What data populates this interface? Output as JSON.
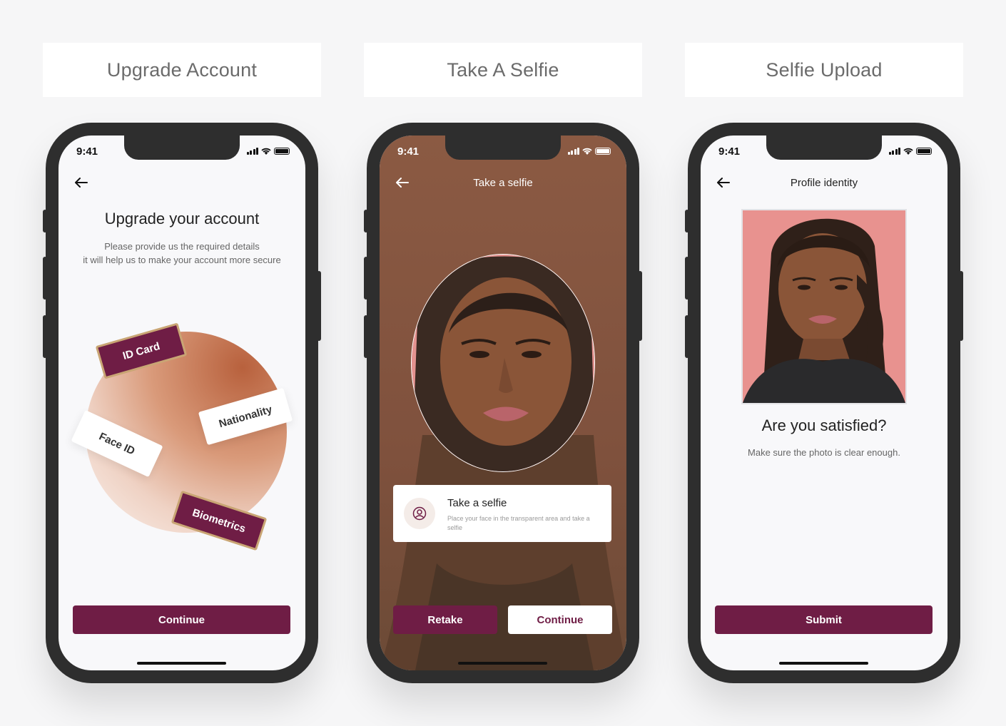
{
  "panels": [
    {
      "title": "Upgrade Account"
    },
    {
      "title": "Take A Selfie"
    },
    {
      "title": "Selfie Upload"
    }
  ],
  "status_time": "9:41",
  "screen1": {
    "heading": "Upgrade your account",
    "subtitle_line1": "Please provide us the required details",
    "subtitle_line2": "it will help us to make your account more secure",
    "tags": {
      "id_card": "ID Card",
      "nationality": "Nationality",
      "face_id": "Face ID",
      "biometrics": "Biometrics"
    },
    "continue_label": "Continue"
  },
  "screen2": {
    "nav_title": "Take a selfie",
    "card_title": "Take a selfie",
    "card_text": "Place your face in the transparent area and take a selfie",
    "retake_label": "Retake",
    "continue_label": "Continue"
  },
  "screen3": {
    "nav_title": "Profile identity",
    "question": "Are you satisfied?",
    "hint": "Make sure the photo is clear enough.",
    "submit_label": "Submit"
  },
  "colors": {
    "brand": "#6f1d45",
    "tag_border": "#c9a574",
    "background": "#f6f6f7"
  },
  "icons": [
    "back-arrow-icon",
    "signal-icon",
    "wifi-icon",
    "battery-icon",
    "user-circle-icon"
  ]
}
